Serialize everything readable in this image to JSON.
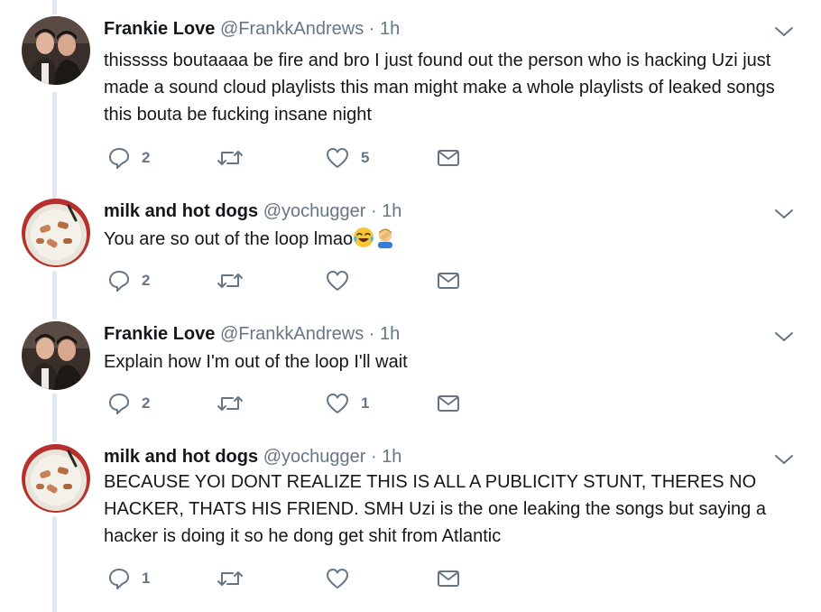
{
  "colors": {
    "icon": "#657786",
    "thread_line": "#e1e8ed",
    "text": "#14171a"
  },
  "tweets": [
    {
      "name": "Frankie Love",
      "handle": "@FrankkAndrews",
      "separator": "·",
      "time": "1h",
      "text": "thisssss boutaaaa be fire and bro I just found out the person who is hacking Uzi just made a sound cloud playlists this man might make a whole playlists of leaked songs this bouta be fucking insane night",
      "replies": "2",
      "retweets": "",
      "likes": "5",
      "avatar": "two-men-photo"
    },
    {
      "name": "milk and hot dogs",
      "handle": "@yochugger",
      "separator": "·",
      "time": "1h",
      "text": "You are so out of the loop lmao",
      "emojis": [
        "face-with-tears-of-joy-emoji",
        "man-facepalming-emoji"
      ],
      "replies": "2",
      "retweets": "",
      "likes": "",
      "avatar": "bowl-of-milk-and-hot-dogs-photo"
    },
    {
      "name": "Frankie Love",
      "handle": "@FrankkAndrews",
      "separator": "·",
      "time": "1h",
      "text": "Explain how I'm out of the loop I'll wait",
      "replies": "2",
      "retweets": "",
      "likes": "1",
      "avatar": "two-men-photo"
    },
    {
      "name": "milk and hot dogs",
      "handle": "@yochugger",
      "separator": "·",
      "time": "1h",
      "text": "BECAUSE YOI DONT REALIZE THIS IS ALL A PUBLICITY STUNT, THERES NO HACKER, THATS HIS FRIEND. SMH Uzi is the one leaking the songs but saying a hacker is doing it so he dong get shit from Atlantic",
      "replies": "1",
      "retweets": "",
      "likes": "",
      "avatar": "bowl-of-milk-and-hot-dogs-photo"
    }
  ]
}
